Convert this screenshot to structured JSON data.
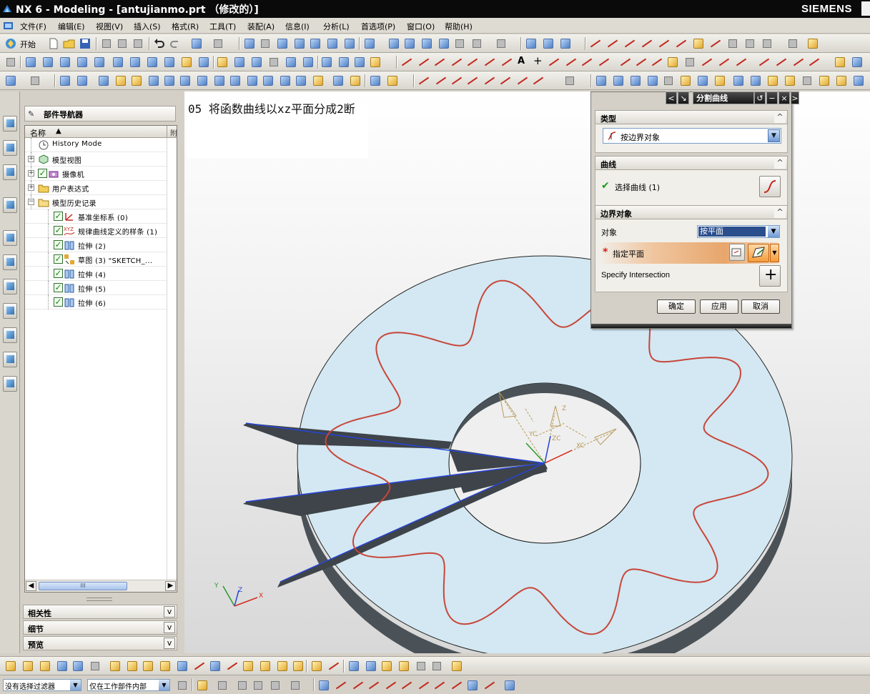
{
  "window": {
    "title": "NX 6 - Modeling - [antujianmo.prt （修改的）]",
    "brand": "SIEMENS"
  },
  "menu": [
    "文件(F)",
    "编辑(E)",
    "视图(V)",
    "插入(S)",
    "格式(R)",
    "工具(T)",
    "装配(A)",
    "信息(I)",
    "分析(L)",
    "首选项(P)",
    "窗口(O)",
    "帮助(H)"
  ],
  "toolbar": {
    "start_label": "开始"
  },
  "navigator": {
    "title": "部件导航器",
    "column_name": "名称",
    "sort_indicator": "▲",
    "column_extra": "附",
    "items": [
      {
        "label": "History Mode",
        "icon": "clock-icon",
        "indent": 0,
        "expandable": false,
        "checked": false
      },
      {
        "label": "模型视图",
        "icon": "model-views-icon",
        "indent": 0,
        "expandable": true,
        "checked": false
      },
      {
        "label": "摄像机",
        "icon": "camera-icon",
        "indent": 0,
        "expandable": true,
        "checked": true
      },
      {
        "label": "用户表达式",
        "icon": "folder-icon",
        "indent": 0,
        "expandable": true,
        "checked": false
      },
      {
        "label": "模型历史记录",
        "icon": "folder-open-icon",
        "indent": 0,
        "expandable": true,
        "checked": false
      },
      {
        "label": "基准坐标系 (0)",
        "icon": "datum-csys-icon",
        "indent": 1,
        "expandable": false,
        "checked": true
      },
      {
        "label": "规律曲线定义的样条 (1)",
        "icon": "law-curve-icon",
        "indent": 1,
        "expandable": false,
        "checked": true
      },
      {
        "label": "拉伸 (2)",
        "icon": "extrude-icon",
        "indent": 1,
        "expandable": false,
        "checked": true
      },
      {
        "label": "草图 (3) \"SKETCH_...",
        "icon": "sketch-icon",
        "indent": 1,
        "expandable": false,
        "checked": true
      },
      {
        "label": "拉伸 (4)",
        "icon": "extrude-icon",
        "indent": 1,
        "expandable": false,
        "checked": true
      },
      {
        "label": "拉伸 (5)",
        "icon": "extrude-icon",
        "indent": 1,
        "expandable": false,
        "checked": true
      },
      {
        "label": "拉伸 (6)",
        "icon": "extrude-icon",
        "indent": 1,
        "expandable": false,
        "checked": true
      }
    ],
    "scroll_thumb": "III",
    "sections": [
      "相关性",
      "细节",
      "预览"
    ]
  },
  "viewport": {
    "note": "05 将函数曲线以xz平面分成2断",
    "csys_labels": {
      "x": "X",
      "y": "Y",
      "z": "Z",
      "xc": "XC",
      "yc": "YC",
      "zc": "ZC"
    }
  },
  "dialog": {
    "title": "分割曲线",
    "type_section": "类型",
    "type_value": "按边界对象",
    "curve_section": "曲线",
    "select_curve": "选择曲线 (1)",
    "boundary_section": "边界对象",
    "object_label": "对象",
    "object_value": "按平面",
    "specify_plane": "指定平面",
    "required_mark": "*",
    "specify_intersection": "Specify Intersection",
    "ok": "确定",
    "apply": "应用",
    "cancel": "取消"
  },
  "statusbar": {
    "filter_value": "没有选择过滤器",
    "scope_value": "仅在工作部件内部"
  },
  "colors": {
    "curve": "#c8463a",
    "disk_face": "#d3e8f2",
    "disk_side": "#4a5258",
    "blue_lines": "#2744d8"
  }
}
